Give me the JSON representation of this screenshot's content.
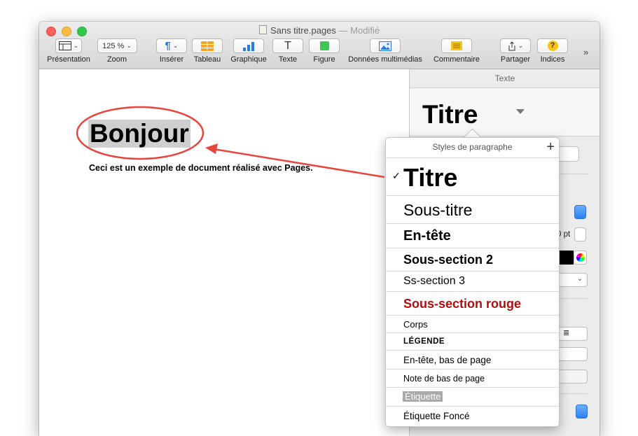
{
  "window": {
    "title": "Sans titre.pages",
    "separator": "—",
    "status": "Modifié"
  },
  "toolbar": {
    "presentation": "Présentation",
    "zoom_value": "125 %",
    "zoom": "Zoom",
    "inserer": "Insérer",
    "tableau": "Tableau",
    "graphique": "Graphique",
    "texte": "Texte",
    "texte_glyph": "T",
    "figure": "Figure",
    "donnees": "Données multimédias",
    "commentaire": "Commentaire",
    "partager": "Partager",
    "indices": "Indices",
    "indices_glyph": "?",
    "more": "»"
  },
  "document": {
    "title": "Bonjour",
    "body": "Ceci est un exemple de document réalisé avec Pages."
  },
  "inspector": {
    "header": "Texte",
    "current_style": "Titre",
    "size_partial": "0 pt"
  },
  "styles_popup": {
    "header": "Styles de paragraphe",
    "add": "+",
    "check": "✓",
    "items": [
      "Titre",
      "Sous-titre",
      "En-tête",
      "Sous-section 2",
      "Ss-section 3",
      "Sous-section rouge",
      "Corps",
      "LÉGENDE",
      "En-tête, bas de page",
      "Note de bas de page",
      "Étiquette",
      "Étiquette Foncé"
    ]
  },
  "colors": {
    "annotation": "#e8453c",
    "red_style": "#b00e0e",
    "accent_blue": "#2b7ff0"
  }
}
